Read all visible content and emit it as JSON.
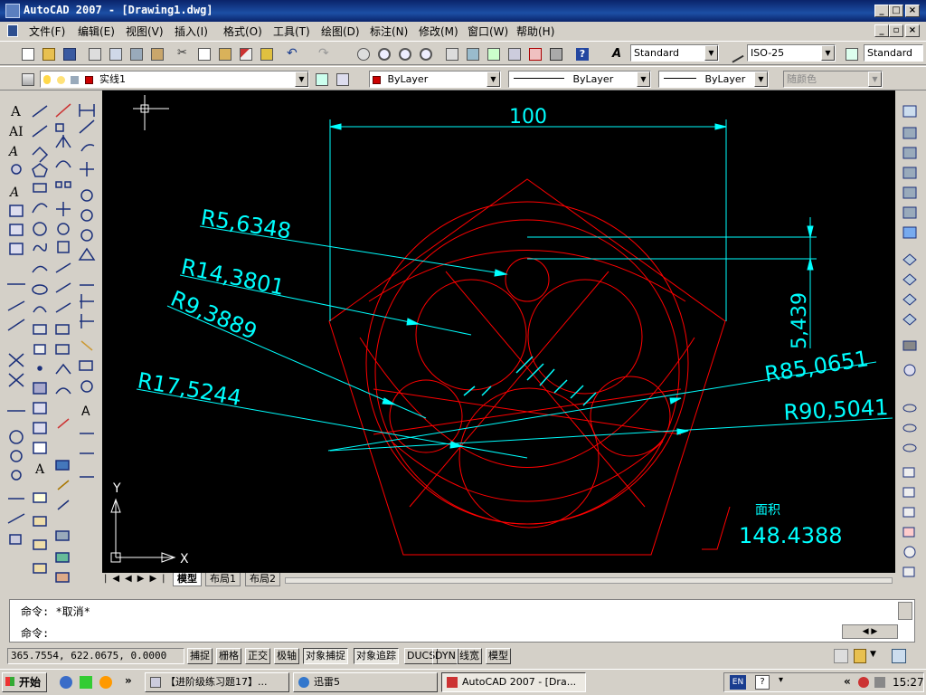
{
  "window": {
    "title": "AutoCAD 2007 - [Drawing1.dwg]",
    "min": "_",
    "max": "□",
    "close": "×"
  },
  "menu": [
    {
      "label": "文件(F)"
    },
    {
      "label": "编辑(E)"
    },
    {
      "label": "视图(V)"
    },
    {
      "label": "插入(I)"
    },
    {
      "label": "格式(O)"
    },
    {
      "label": "工具(T)"
    },
    {
      "label": "绘图(D)"
    },
    {
      "label": "标注(N)"
    },
    {
      "label": "修改(M)"
    },
    {
      "label": "窗口(W)"
    },
    {
      "label": "帮助(H)"
    }
  ],
  "styles": {
    "text_style": "Standard",
    "dim_style": "ISO-25",
    "table_style": "Standard"
  },
  "layers": {
    "current": "实线1",
    "color": "ByLayer",
    "linetype": "ByLayer",
    "lineweight": "ByLayer",
    "plotstyle": "随颜色"
  },
  "drawing": {
    "dim_top": "100",
    "dim_vertical": "5,439",
    "r1": "R5,6348",
    "r2": "R14,3801",
    "r3": "R9,3889",
    "r4": "R17,5244",
    "r5": "R85,0651",
    "r6": "R90,5041",
    "area_label": "面积",
    "area_value": "148.4388",
    "ucs_x": "X",
    "ucs_y": "Y"
  },
  "tabs": [
    {
      "label": "模型",
      "active": true
    },
    {
      "label": "布局1",
      "active": false
    },
    {
      "label": "布局2",
      "active": false
    }
  ],
  "command": {
    "line1": "命令: *取消*",
    "line2": "命令:"
  },
  "status": {
    "coords": "365.7554, 622.0675, 0.0000",
    "buttons": [
      {
        "label": "捕捉",
        "on": false
      },
      {
        "label": "栅格",
        "on": false
      },
      {
        "label": "正交",
        "on": false
      },
      {
        "label": "极轴",
        "on": false
      },
      {
        "label": "对象捕捉",
        "on": true
      },
      {
        "label": "对象追踪",
        "on": true
      },
      {
        "label": "DUCS",
        "on": false
      },
      {
        "label": "DYN",
        "on": false
      },
      {
        "label": "线宽",
        "on": false
      },
      {
        "label": "模型",
        "on": false
      }
    ]
  },
  "taskbar": {
    "start": "开始",
    "tasks": [
      {
        "label": "【进阶级练习题17】..."
      },
      {
        "label": "迅雷5"
      },
      {
        "label": "AutoCAD 2007 - [Dra..."
      }
    ],
    "lang": "EN",
    "clock": "15:27"
  },
  "colors": {
    "canvas": "#000000",
    "geometry": "#ff0000",
    "dimension": "#00ffff",
    "titlebar": "#0a246a"
  }
}
